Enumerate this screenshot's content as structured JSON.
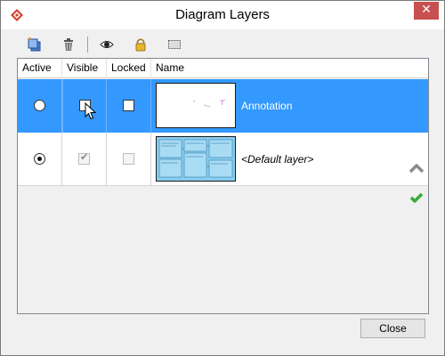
{
  "window": {
    "title": "Diagram Layers",
    "close_glyph": "✕"
  },
  "toolbar": {
    "buttons": [
      {
        "name": "new-layer",
        "icon": "layers-add-icon"
      },
      {
        "name": "delete-layer",
        "icon": "trash-icon"
      },
      {
        "name": "toggle-visibility",
        "icon": "eye-icon"
      },
      {
        "name": "toggle-lock",
        "icon": "lock-icon"
      },
      {
        "name": "select-layer-shapes",
        "icon": "selection-icon"
      }
    ]
  },
  "table": {
    "columns": [
      "Active",
      "Visible",
      "Locked",
      "Name"
    ],
    "rows": [
      {
        "active": false,
        "visible": false,
        "locked": false,
        "name": "Annotation",
        "selected": true
      },
      {
        "active": true,
        "visible": true,
        "locked": false,
        "name": "<Default layer>",
        "selected": false
      }
    ]
  },
  "side_controls": {
    "up_icon": "chevron-up-icon",
    "apply_icon": "check-icon"
  },
  "footer": {
    "close_label": "Close"
  },
  "colors": {
    "selection": "#3399ff",
    "accent_green": "#3aa83a"
  }
}
